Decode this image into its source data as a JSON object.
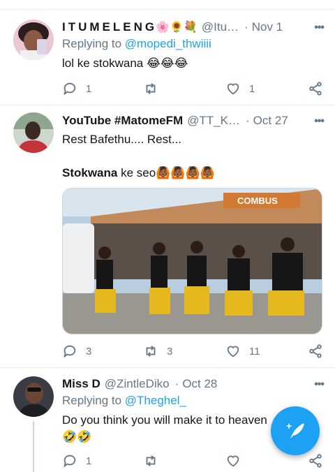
{
  "tweets": [
    {
      "name": "ITUMELENG",
      "name_emoji": "🌸🌻💐",
      "handle": "@Itu…",
      "date": "Nov 1",
      "reply_prefix": "Replying to ",
      "reply_to": "@mopedi_thwiiii",
      "text": "lol ke stokwana 😂😂😂",
      "replies": "1",
      "retweets": "",
      "likes": "1"
    },
    {
      "name": "YouTube #MatomeFM",
      "handle": "@TT_K…",
      "date": "Oct 27",
      "text_line1": "Rest Bafethu.... Rest...",
      "text_line2_bold": "Stokwana",
      "text_line2_rest": " ke seo🙆🏾🙆🏾🙆🏾🙆🏾",
      "media_sign": "COMBUS",
      "replies": "3",
      "retweets": "3",
      "likes": "11"
    },
    {
      "name": "Miss D",
      "handle": "@ZintleDiko",
      "date": "Oct 28",
      "reply_prefix": "Replying to ",
      "reply_to": "@Theghel_",
      "text_line1": "Do you think you will make it to heaven",
      "text_line2": "🤣🤣",
      "replies": "1",
      "retweets": "",
      "likes": ""
    }
  ],
  "more_label": "•••",
  "compose_label": "+",
  "colors": {
    "accent": "#1da1f2",
    "muted": "#657786",
    "divider": "#e6ecf0"
  }
}
